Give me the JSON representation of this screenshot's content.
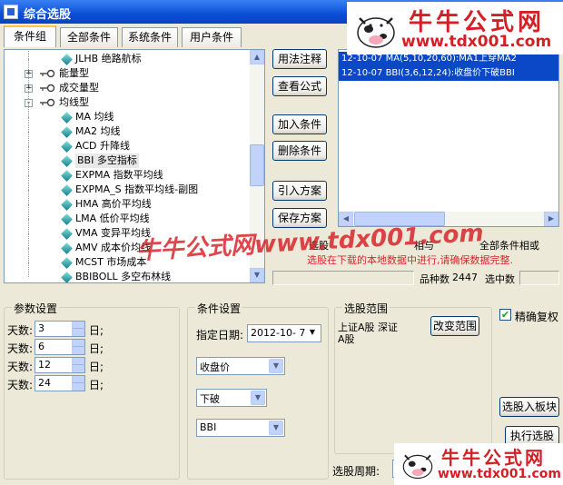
{
  "window": {
    "title": "综合选股"
  },
  "tabs": [
    "条件组",
    "全部条件",
    "系统条件",
    "用户条件"
  ],
  "tree": {
    "items": [
      {
        "label": "JLHB 绝路航标",
        "kind": "leaf"
      },
      {
        "label": "能量型",
        "kind": "group"
      },
      {
        "label": "成交量型",
        "kind": "group"
      },
      {
        "label": "均线型",
        "kind": "group-open"
      },
      {
        "label": "MA 均线",
        "kind": "leaf"
      },
      {
        "label": "MA2 均线",
        "kind": "leaf"
      },
      {
        "label": "ACD 升降线",
        "kind": "leaf"
      },
      {
        "label": "BBI 多空指标",
        "kind": "leaf-selected"
      },
      {
        "label": "EXPMA 指数平均线",
        "kind": "leaf"
      },
      {
        "label": "EXPMA_S 指数平均线-副图",
        "kind": "leaf"
      },
      {
        "label": "HMA 高价平均线",
        "kind": "leaf"
      },
      {
        "label": "LMA 低价平均线",
        "kind": "leaf"
      },
      {
        "label": "VMA 变异平均线",
        "kind": "leaf"
      },
      {
        "label": "AMV 成本价均线",
        "kind": "leaf"
      },
      {
        "label": "MCST 市场成本",
        "kind": "leaf"
      },
      {
        "label": "BBIBOLL 多空布林线",
        "kind": "leaf"
      }
    ],
    "expander_plus": "+",
    "expander_minus": "-"
  },
  "actions": {
    "usage": "用法注释",
    "formula": "查看公式",
    "add": "加入条件",
    "delete": "删除条件",
    "import": "引入方案",
    "save": "保存方案"
  },
  "conditions": {
    "items": [
      "12-10-07 MA(5,10,20,60):MA1上穿MA2",
      "12-10-07 BBI(3,6,12,24):收盘价下破BBI"
    ]
  },
  "notice": {
    "line1_prefix": "选股",
    "line1_suffix": "相与",
    "line1_right": "全部条件相或",
    "line2": "选股在下载的本地数据中进行,请确保数据完整."
  },
  "status": {
    "count_label": "品种数",
    "count_value": "2447",
    "selected_label": "选中数",
    "selected_value": ""
  },
  "params": {
    "title": "参数设置",
    "rows": [
      {
        "label": "天数:",
        "value": "3",
        "unit": "日;"
      },
      {
        "label": "天数:",
        "value": "6",
        "unit": "日;"
      },
      {
        "label": "天数:",
        "value": "12",
        "unit": "日;"
      },
      {
        "label": "天数:",
        "value": "24",
        "unit": "日;"
      }
    ]
  },
  "cond_settings": {
    "title": "条件设置",
    "date_label": "指定日期:",
    "date_value": "2012-10- 7",
    "field1": "收盘价",
    "field2": "下破",
    "field3": "BBI"
  },
  "scope": {
    "title": "选股范围",
    "text1": "上证A股 深证",
    "text2": "A股",
    "change_button": "改变范围",
    "period_label": "选股周期:"
  },
  "options": {
    "exact_fq_label": "精确复权",
    "exact_fq_checked": true,
    "to_block": "选股入板块",
    "execute": "执行选股"
  },
  "watermark": {
    "brand": "牛牛公式网",
    "url": "www.tdx001.com",
    "overlay_text": "牛牛公式网www.tdx001.com"
  },
  "colors": {
    "title_blue": "#0a4fd6",
    "list_blue": "#0a48c8",
    "notice_red": "#d8262c"
  }
}
